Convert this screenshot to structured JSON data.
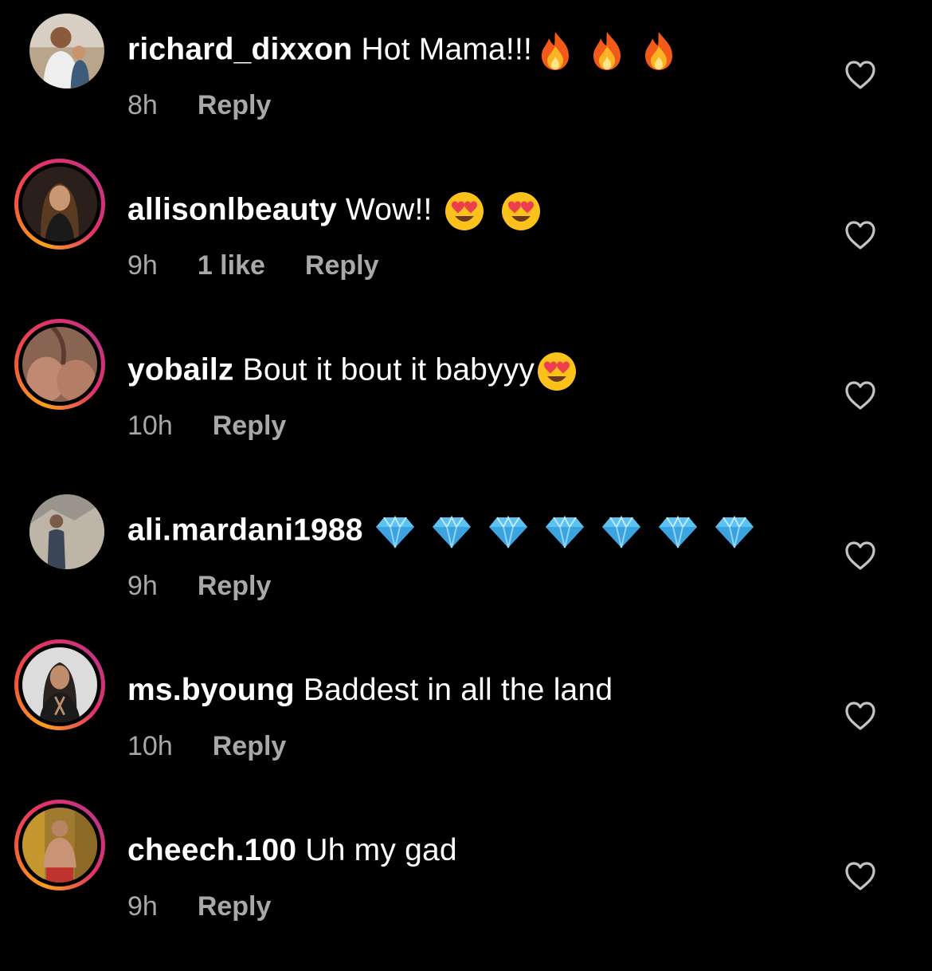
{
  "colors": {
    "background": "#000000",
    "text": "#ffffff",
    "meta": "#a8a8a8"
  },
  "comments": [
    {
      "username": "richard_dixxon",
      "text": "Hot Mama!!!",
      "emoji": [
        "fire-emoji",
        "fire-emoji",
        "fire-emoji"
      ],
      "time": "8h",
      "likes": "",
      "reply": "Reply",
      "story_ring": false,
      "avatar_icon": "avatar-photo"
    },
    {
      "username": "allisonlbeauty",
      "text": "Wow!!",
      "emoji": [
        "heart-eyes-emoji",
        "heart-eyes-emoji"
      ],
      "time": "9h",
      "likes": "1 like",
      "reply": "Reply",
      "story_ring": true,
      "avatar_icon": "avatar-photo"
    },
    {
      "username": "yobailz",
      "text": "Bout it bout it babyyy",
      "emoji": [
        "heart-eyes-emoji"
      ],
      "time": "10h",
      "likes": "",
      "reply": "Reply",
      "story_ring": true,
      "avatar_icon": "avatar-photo"
    },
    {
      "username": "ali.mardani1988",
      "text": "",
      "emoji": [
        "gem-emoji",
        "gem-emoji",
        "gem-emoji",
        "gem-emoji",
        "gem-emoji",
        "gem-emoji",
        "gem-emoji"
      ],
      "time": "9h",
      "likes": "",
      "reply": "Reply",
      "story_ring": false,
      "avatar_icon": "avatar-photo"
    },
    {
      "username": "ms.byoung",
      "text": "Baddest in all the land",
      "emoji": [],
      "time": "10h",
      "likes": "",
      "reply": "Reply",
      "story_ring": true,
      "avatar_icon": "avatar-photo"
    },
    {
      "username": "cheech.100",
      "text": "Uh my gad",
      "emoji": [],
      "time": "9h",
      "likes": "",
      "reply": "Reply",
      "story_ring": true,
      "avatar_icon": "avatar-photo"
    }
  ]
}
